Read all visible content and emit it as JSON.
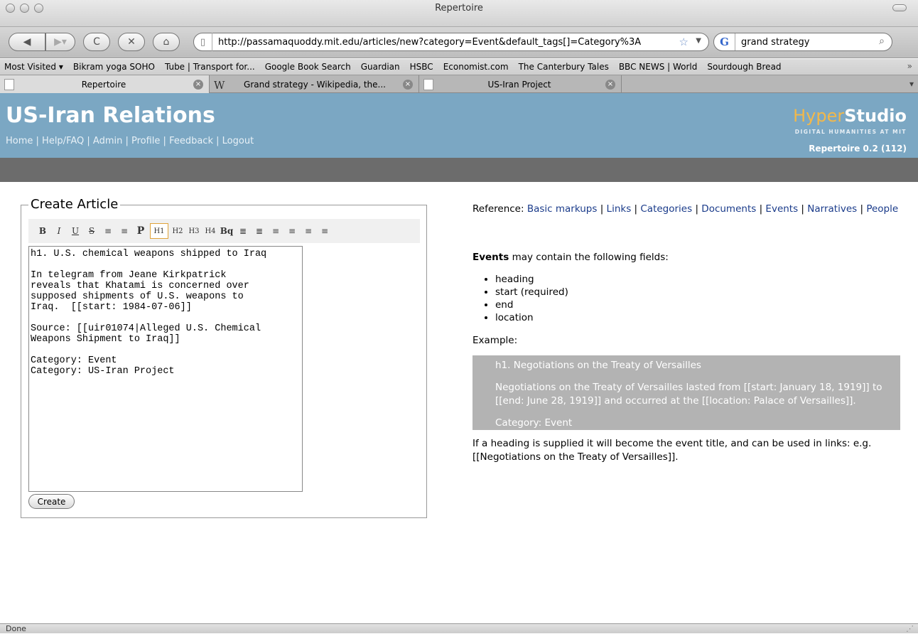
{
  "window": {
    "title": "Repertoire"
  },
  "toolbar": {
    "back_icon": "back-arrow",
    "forward_icon": "forward-arrow",
    "url": "http://passamaquoddy.mit.edu/articles/new?category=Event&default_tags[]=Category%3A",
    "search_engine": "G",
    "search_value": "grand strategy"
  },
  "bookmarks": [
    "Most Visited ▾",
    "Bikram yoga SOHO",
    "Tube | Transport for...",
    "Google Book Search",
    "Guardian",
    "HSBC",
    "Economist.com",
    "The Canterbury Tales",
    "BBC NEWS | World",
    "Sourdough Bread"
  ],
  "tabs": [
    {
      "label": "Repertoire"
    },
    {
      "label": "Grand strategy - Wikipedia, the..."
    },
    {
      "label": "US-Iran Project"
    }
  ],
  "site": {
    "title": "US-Iran Relations",
    "nav": [
      "Home",
      "Help/FAQ",
      "Admin",
      "Profile",
      "Feedback",
      "Logout"
    ],
    "brand_hyper": "Hyper",
    "brand_studio": "Studio",
    "brand_sub": "DIGITAL HUMANITIES AT MIT",
    "version": "Repertoire 0.2 (112)"
  },
  "form": {
    "legend": "Create Article",
    "editor_buttons": [
      "B",
      "I",
      "U",
      "S",
      "≡",
      "≡",
      "P",
      "H1",
      "H2",
      "H3",
      "H4",
      "Bq",
      "≣",
      "≣",
      "≡",
      "≡",
      "≡",
      "≡"
    ],
    "text": "h1. U.S. chemical weapons shipped to Iraq\n\nIn telegram from Jeane Kirkpatrick\nreveals that Khatami is concerned over\nsupposed shipments of U.S. weapons to\nIraq.  [[start: 1984-07-06]]\n\nSource: [[uir01074|Alleged U.S. Chemical\nWeapons Shipment to Iraq]]\n\nCategory: Event\nCategory: US-Iran Project",
    "submit": "Create"
  },
  "reference": {
    "prefix": "Reference:",
    "links": [
      "Basic markups",
      "Links",
      "Categories",
      "Documents",
      "Events",
      "Narratives",
      "People"
    ],
    "fields_strong": "Events",
    "fields_rest": " may contain the following fields:",
    "fields": [
      "heading",
      "start (required)",
      "end",
      "location"
    ],
    "example_label": "Example:",
    "example_lines": [
      "h1. Negotiations on the Treaty of Versailles",
      "Negotiations on the Treaty of Versailles lasted from [[start: January 18, 1919]] to [[end: June 28, 1919]] and occurred at the [[location: Palace of Versailles]].",
      "Category: Event"
    ],
    "heading_note": "If a heading is supplied it will become the event title, and can be used in links: e.g. [[Negotiations on the Treaty of Versailles]]."
  },
  "status": {
    "text": "Done"
  }
}
